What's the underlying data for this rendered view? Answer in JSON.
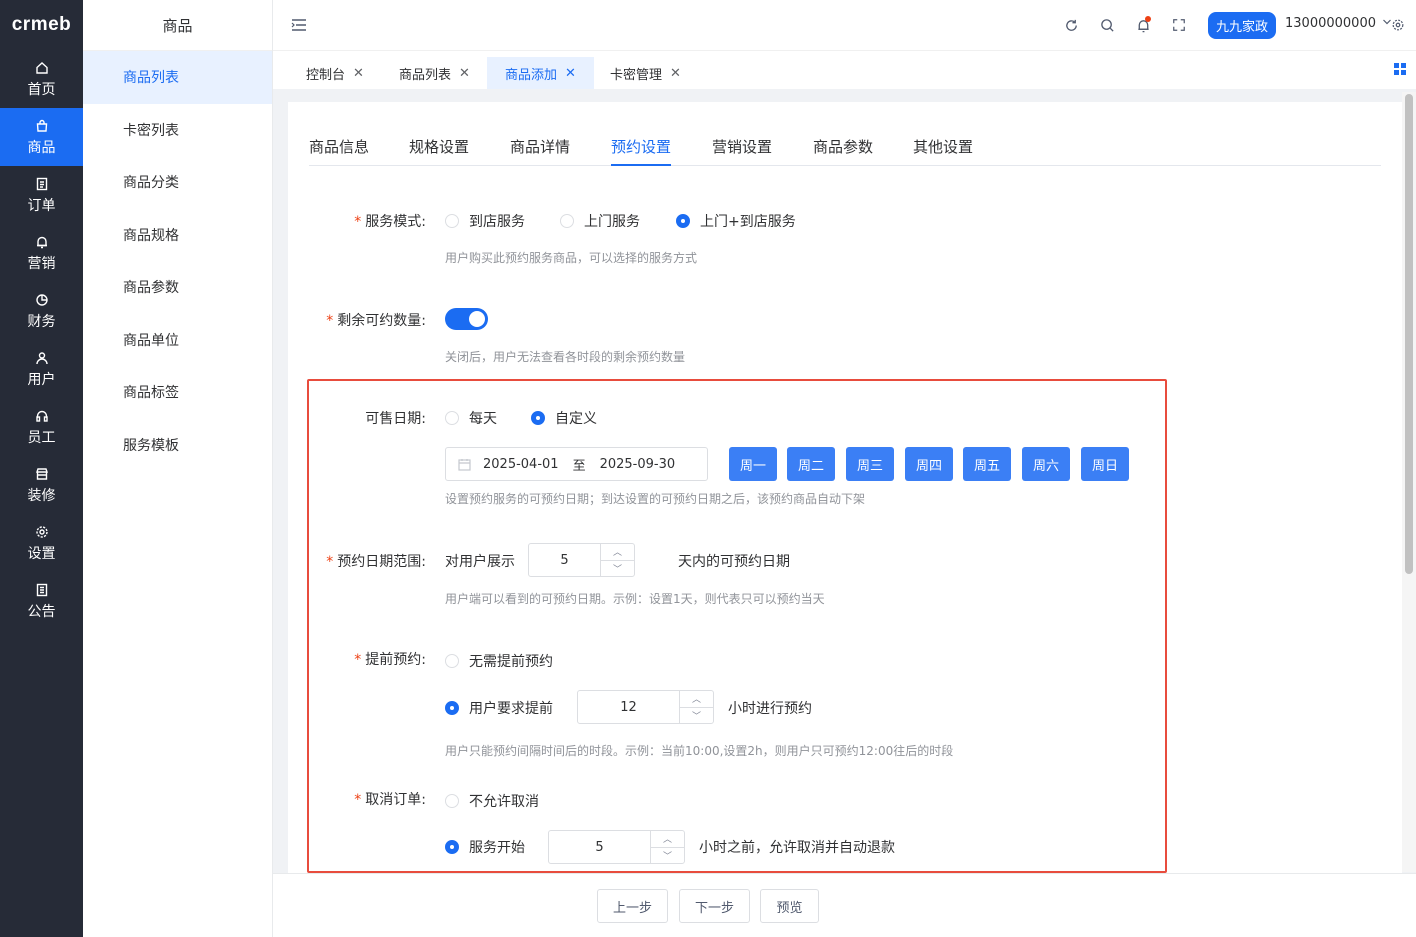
{
  "brand": {
    "logo_text": "crmeb"
  },
  "nav": [
    {
      "label": "首页",
      "icon": "home-icon"
    },
    {
      "label": "商品",
      "icon": "bag-icon",
      "active": true
    },
    {
      "label": "订单",
      "icon": "document-icon"
    },
    {
      "label": "营销",
      "icon": "bell-icon"
    },
    {
      "label": "财务",
      "icon": "pie-icon"
    },
    {
      "label": "用户",
      "icon": "user-icon"
    },
    {
      "label": "员工",
      "icon": "headset-icon"
    },
    {
      "label": "装修",
      "icon": "store-icon"
    },
    {
      "label": "设置",
      "icon": "gear-icon"
    },
    {
      "label": "公告",
      "icon": "notice-icon"
    }
  ],
  "submenu": {
    "title": "商品",
    "items": [
      "商品列表",
      "卡密列表",
      "商品分类",
      "商品规格",
      "商品参数",
      "商品单位",
      "商品标签",
      "服务模板"
    ]
  },
  "header": {
    "shop_name": "九九家政",
    "phone": "13000000000"
  },
  "tabs": [
    "控制台",
    "商品列表",
    "商品添加",
    "卡密管理"
  ],
  "form_tabs": [
    "商品信息",
    "规格设置",
    "商品详情",
    "预约设置",
    "营销设置",
    "商品参数",
    "其他设置"
  ],
  "service_mode": {
    "label": "服务模式:",
    "options": [
      "到店服务",
      "上门服务",
      "上门+到店服务"
    ],
    "selected": 2,
    "hint": "用户购买此预约服务商品，可以选择的服务方式"
  },
  "remaining": {
    "label": "剩余可约数量:",
    "enabled": true,
    "hint": "关闭后，用户无法查看各时段的剩余预约数量"
  },
  "sale_date": {
    "label": "可售日期:",
    "options": [
      "每天",
      "自定义"
    ],
    "selected": 1,
    "start": "2025-04-01",
    "to": "至",
    "end": "2025-09-30",
    "weekdays": [
      "周一",
      "周二",
      "周三",
      "周四",
      "周五",
      "周六",
      "周日"
    ],
    "hint": "设置预约服务的可预约日期；到达设置的可预约日期之后，该预约商品自动下架"
  },
  "date_range": {
    "label": "预约日期范围:",
    "prefix": "对用户展示",
    "value": "5",
    "suffix": "天内的可预约日期",
    "hint": "用户端可以看到的可预约日期。示例：设置1天，则代表只可以预约当天"
  },
  "advance": {
    "label": "提前预约:",
    "option_none": "无需提前预约",
    "option_required": "用户要求提前",
    "value": "12",
    "suffix": "小时进行预约",
    "selected": 1,
    "hint": "用户只能预约间隔时间后的时段。示例：当前10:00,设置2h，则用户只可预约12:00往后的时段"
  },
  "cancel": {
    "label": "取消订单:",
    "option_none": "不允许取消",
    "option_allow": "服务开始",
    "value": "5",
    "suffix": "小时之前，允许取消并自动退款",
    "selected": 1
  },
  "footer": {
    "prev": "上一步",
    "next": "下一步",
    "preview": "预览"
  },
  "colors": {
    "primary": "#1b6cf2",
    "nav_bg": "#262b37",
    "highlight_border": "#e84c3d"
  }
}
